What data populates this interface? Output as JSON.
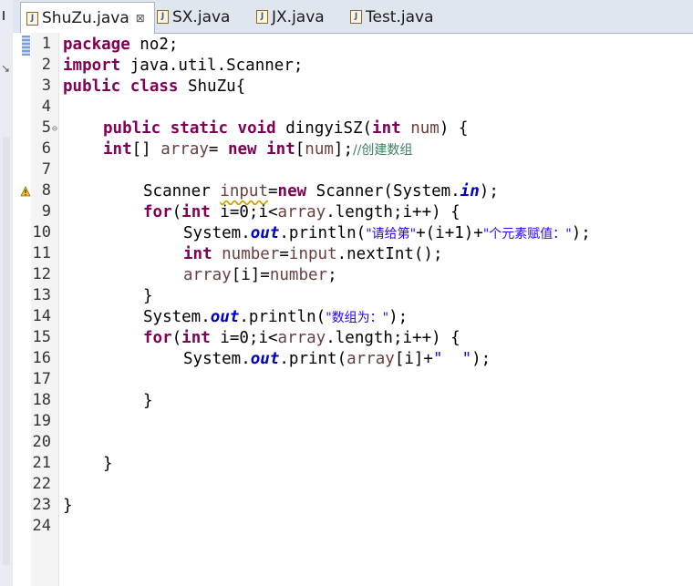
{
  "tabs": [
    {
      "label": "ShuZu.java",
      "active": true,
      "close": "⊠"
    },
    {
      "label": "SX.java",
      "active": false
    },
    {
      "label": "JX.java",
      "active": false
    },
    {
      "label": "Test.java",
      "active": false
    }
  ],
  "line_numbers": [
    "1",
    "2",
    "3",
    "4",
    "5",
    "6",
    "7",
    "8",
    "9",
    "10",
    "11",
    "12",
    "13",
    "14",
    "15",
    "16",
    "17",
    "18",
    "19",
    "20",
    "21",
    "22",
    "23",
    "24"
  ],
  "code": {
    "l1_kw": "package",
    "l1_rest": " no2;",
    "l2_kw": "import",
    "l2_rest": " java.util.Scanner;",
    "l3_kw1": "public",
    "l3_kw2": "class",
    "l3_rest": " ShuZu{",
    "l5_kw1": "public",
    "l5_kw2": "static",
    "l5_kw3": "void",
    "l5_name": " dingyiSZ(",
    "l5_kw4": "int",
    "l5_var": " num",
    "l5_end": ") {",
    "l6_kw1": "int",
    "l6_a": "[] ",
    "l6_var": "array",
    "l6_b": "= ",
    "l6_kw2": "new",
    "l6_c": " ",
    "l6_kw3": "int",
    "l6_d": "[",
    "l6_var2": "num",
    "l6_e": "];",
    "l6_cmt": "//创建数组",
    "l8_a": "Scanner ",
    "l8_var": "input",
    "l8_b": "=",
    "l8_kw": "new",
    "l8_c": " Scanner(System.",
    "l8_fld": "in",
    "l8_d": ");",
    "l9_kw1": "for",
    "l9_a": "(",
    "l9_kw2": "int",
    "l9_b": " i=0;i<",
    "l9_var": "array",
    "l9_c": ".length;i++) {",
    "l10_a": "System.",
    "l10_fld": "out",
    "l10_b": ".println(",
    "l10_s1": "\"请给第\"",
    "l10_c": "+(i+1)+",
    "l10_s2": "\"个元素赋值：\"",
    "l10_d": ");",
    "l11_kw": "int",
    "l11_var": " number",
    "l11_a": "=",
    "l11_var2": "input",
    "l11_b": ".nextInt();",
    "l12_var": "array",
    "l12_a": "[i]=",
    "l12_var2": "number",
    "l12_b": ";",
    "l13": "}",
    "l14_a": "System.",
    "l14_fld": "out",
    "l14_b": ".println(",
    "l14_s": "\"数组为：\"",
    "l14_c": ");",
    "l15_kw1": "for",
    "l15_a": "(",
    "l15_kw2": "int",
    "l15_b": " i=0;i<",
    "l15_var": "array",
    "l15_c": ".length;i++) {",
    "l16_a": "System.",
    "l16_fld": "out",
    "l16_b": ".print(",
    "l16_var": "array",
    "l16_c": "[i]+",
    "l16_s": "\"  \"",
    "l16_d": ");",
    "l18": "}",
    "l21": "}",
    "l23": "}"
  },
  "colors": {
    "keyword": "#7f0055",
    "string": "#2a00ff",
    "comment": "#3f7f5f",
    "field": "#0000c0",
    "variable": "#6a3e3e"
  },
  "icons": {
    "tab_file": "java-file-icon",
    "warning": "warning-icon",
    "fold": "fold-collapse-icon"
  }
}
